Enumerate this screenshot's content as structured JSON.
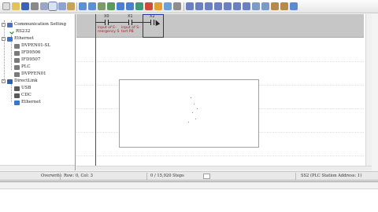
{
  "tree": {
    "items": [
      {
        "label": "Communication Setting",
        "icon": "folder-network-icon",
        "depth": 0,
        "expander": "-"
      },
      {
        "label": "RS232",
        "icon": "checkmark-icon",
        "depth": 1
      },
      {
        "label": "Ethernet",
        "icon": "network-icon",
        "depth": 0,
        "expander": "-"
      },
      {
        "label": "DVPEN01-SL",
        "icon": "device-icon",
        "depth": 1
      },
      {
        "label": "IFD9506",
        "icon": "device-icon",
        "depth": 1
      },
      {
        "label": "IFD9507",
        "icon": "device-icon",
        "depth": 1
      },
      {
        "label": "PLC",
        "icon": "device-icon",
        "depth": 1
      },
      {
        "label": "DVPFEN01",
        "icon": "device-icon",
        "depth": 1
      },
      {
        "label": "DirectLink",
        "icon": "link-icon",
        "depth": 0,
        "expander": "-"
      },
      {
        "label": "USB",
        "icon": "usb-icon",
        "depth": 1
      },
      {
        "label": "CDC",
        "icon": "usb-icon",
        "depth": 1
      },
      {
        "label": "Ethernet",
        "icon": "network-icon",
        "depth": 1
      }
    ]
  },
  "ladder": {
    "contacts": [
      {
        "label": "X0",
        "comment": "input of E-\nmergency S"
      },
      {
        "label": "X1",
        "comment": "input of S-\ntart PB"
      },
      {
        "label": "X2",
        "comment": ""
      }
    ]
  },
  "status": {
    "overwrite": "Overwrite",
    "position": "Row: 0, Col: 3",
    "steps": "0 / 15,920 Steps",
    "station": "SS2 (PLC Station Address: 1)"
  },
  "colors": {
    "rung_band": "#c6c6c6",
    "cursor": "#1b32a8",
    "comment_text": "#b01818"
  }
}
